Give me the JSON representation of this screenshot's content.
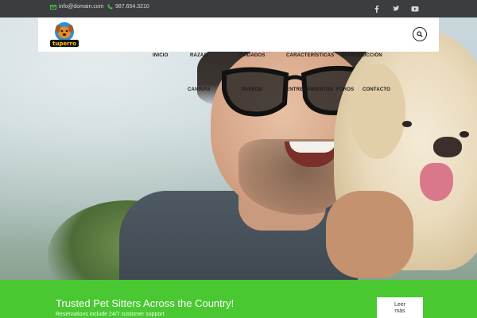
{
  "topbar": {
    "email": "info@domain.com",
    "phone": "987.654.3210",
    "social": [
      "facebook-icon",
      "twitter-icon",
      "youtube-icon"
    ]
  },
  "header": {
    "logo_text": "tuperro"
  },
  "nav": [
    {
      "label": "INICIO"
    },
    {
      "label": "RAZAS"
    },
    {
      "label": "CUIDADOS"
    },
    {
      "label": "CARACTERÍSTICAS"
    },
    {
      "label": "REPRODUCCIÓN"
    },
    {
      "label": "CANINAS"
    },
    {
      "label": "PASEOS"
    },
    {
      "label": "ENTRENAMIENTOS"
    },
    {
      "label": "FOROS"
    },
    {
      "label": "CONTACTO"
    }
  ],
  "banner": {
    "title": "Trusted Pet Sitters Across the Country!",
    "subtitle": "Reservations include 24/7 customer support",
    "button_label_1": "Leer",
    "button_label_2": "más"
  },
  "colors": {
    "topbar": "#3b3d40",
    "accent_green": "#49c832",
    "icon_green": "#46c33a"
  }
}
